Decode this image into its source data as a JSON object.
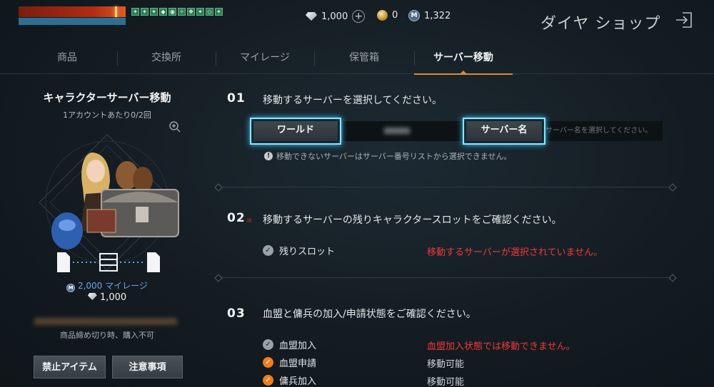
{
  "hud": {
    "buff_icons": [
      "buff-1",
      "buff-2",
      "buff-3",
      "buff-4",
      "buff-5",
      "buff-6",
      "buff-7",
      "buff-8"
    ]
  },
  "currency": {
    "diamond": "1,000",
    "gold": "0",
    "mileage": "1,322"
  },
  "header": {
    "title": "ダイヤ ショップ"
  },
  "tabs": [
    {
      "label": "商品"
    },
    {
      "label": "交換所"
    },
    {
      "label": "マイレージ"
    },
    {
      "label": "保管箱"
    },
    {
      "label": "サーバー移動",
      "active": true
    }
  ],
  "item": {
    "title": "キャラクターサーバー移動",
    "limit": "1アカウントあたり0/2回",
    "price_mileage": "2,000 マイレージ",
    "price_diamond": "1,000",
    "soldout_note": "商品締め切り時、購入不可",
    "ban_button": "禁止アイテム",
    "notes_button": "注意事項"
  },
  "steps": {
    "s1": {
      "num": "01",
      "text": "移動するサーバーを選択してください。",
      "world_button": "ワールド",
      "server_button": "サーバー名",
      "server_placeholder": "サーバー名を選択してください。",
      "notice": "移動できないサーバーはサーバー番号リストから選択できません。"
    },
    "s2": {
      "num": "02",
      "text": "移動するサーバーの残りキャラクタースロットをご確認ください。",
      "row_label": "残りスロット",
      "row_status": "移動するサーバーが選択されていません。"
    },
    "s3": {
      "num": "03",
      "text": "血盟と傭兵の加入/申請状態をご確認ください。",
      "rows": [
        {
          "label": "血盟加入",
          "status": "血盟加入状態では移動できません。"
        },
        {
          "label": "血盟申請",
          "status": "移動可能"
        },
        {
          "label": "傭兵加入",
          "status": "移動可能"
        }
      ]
    }
  },
  "colors": {
    "accent": "#e08a3a",
    "error": "#ee3a3a",
    "selection_glow": "#8ce6ff",
    "mileage": "#6aa6e8"
  }
}
